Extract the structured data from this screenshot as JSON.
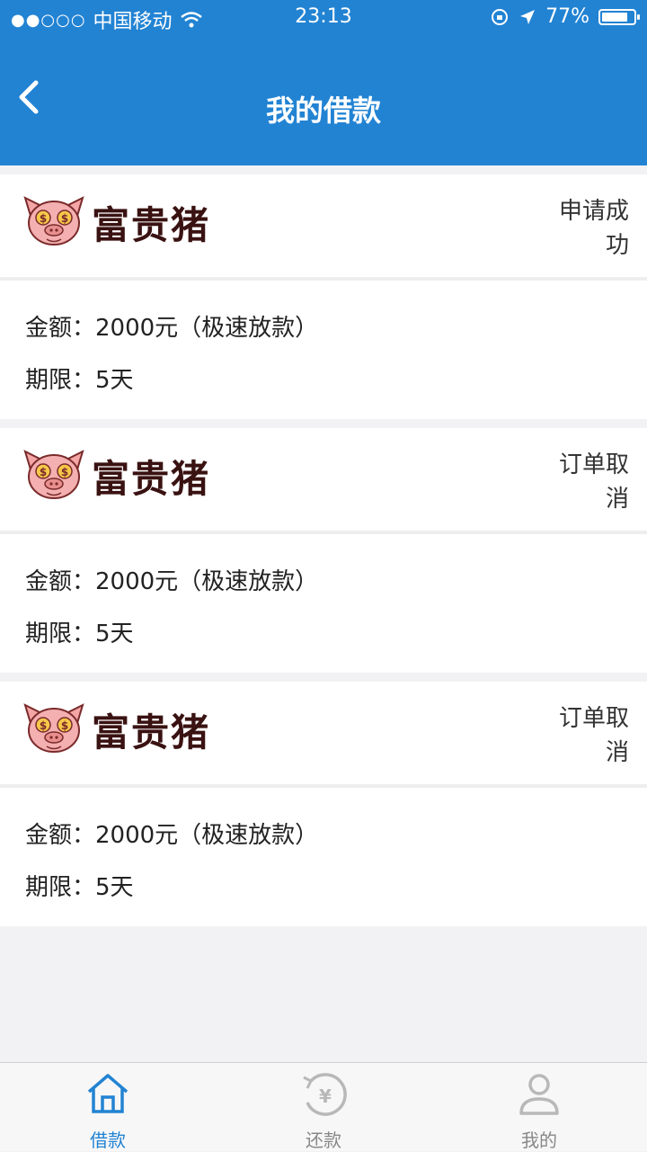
{
  "status_bar": {
    "carrier": "中国移动",
    "time": "23:13",
    "battery": "77%"
  },
  "nav": {
    "title": "我的借款"
  },
  "loans": [
    {
      "brand": "富贵猪",
      "status_line1": "申请成",
      "status_line2": "功",
      "amount_label": "金额：",
      "amount_value": "2000元（极速放款）",
      "term_label": "期限：",
      "term_value": "5天"
    },
    {
      "brand": "富贵猪",
      "status_line1": "订单取",
      "status_line2": "消",
      "amount_label": "金额：",
      "amount_value": "2000元（极速放款）",
      "term_label": "期限：",
      "term_value": "5天"
    },
    {
      "brand": "富贵猪",
      "status_line1": "订单取",
      "status_line2": "消",
      "amount_label": "金额：",
      "amount_value": "2000元（极速放款）",
      "term_label": "期限：",
      "term_value": "5天"
    }
  ],
  "tabs": [
    {
      "label": "借款",
      "icon": "home-icon",
      "active": true
    },
    {
      "label": "还款",
      "icon": "repay-icon",
      "active": false
    },
    {
      "label": "我的",
      "icon": "user-icon",
      "active": false
    }
  ],
  "colors": {
    "primary": "#2283d3",
    "background": "#f2f2f4",
    "brand_text": "#3a1212"
  }
}
